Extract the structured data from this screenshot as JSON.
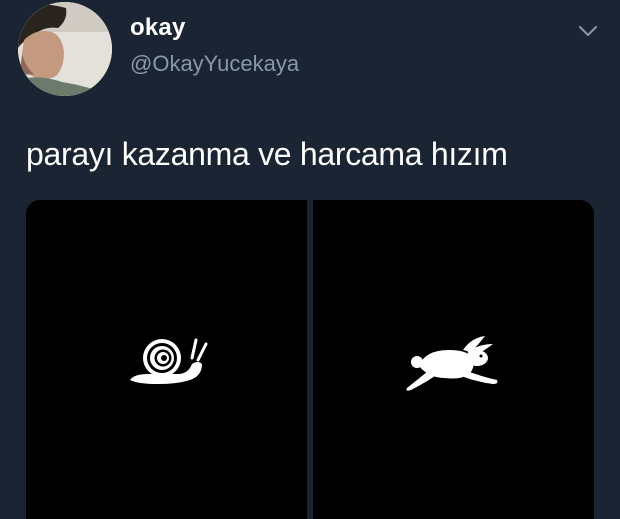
{
  "tweet": {
    "display_name": "okay",
    "handle": "@OkayYucekaya",
    "text": "parayı kazanma ve harcama hızım",
    "more_icon": "chevron-down-icon"
  },
  "media": {
    "images": [
      {
        "icon": "snail-icon",
        "color": "#ffffff",
        "background": "#000000"
      },
      {
        "icon": "rabbit-icon",
        "color": "#ffffff",
        "background": "#000000"
      }
    ]
  },
  "colors": {
    "background": "#1b2433",
    "name": "#ffffff",
    "handle": "#8899a6",
    "text": "#ffffff"
  }
}
